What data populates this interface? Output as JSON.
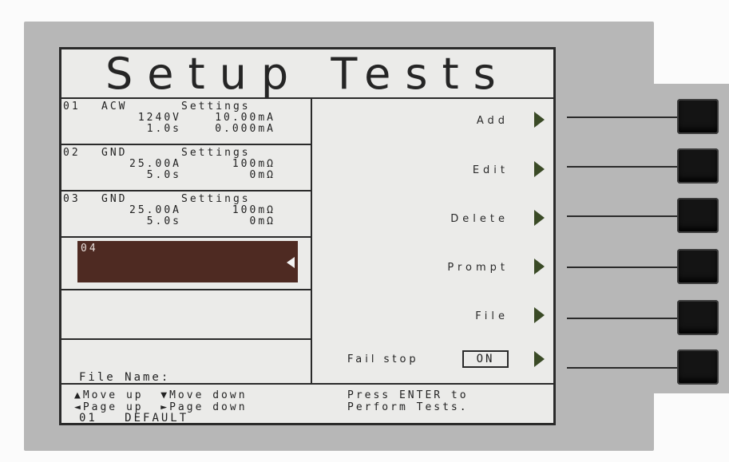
{
  "screen": {
    "title": "Setup Tests"
  },
  "tests": [
    {
      "num": "01",
      "line1": [
        "ACW",
        "Settings"
      ],
      "line2": [
        "1240V",
        "10.00mA"
      ],
      "line3": [
        "1.0s",
        "0.000mA"
      ]
    },
    {
      "num": "02",
      "line1": [
        "GND",
        "Settings"
      ],
      "line2": [
        "25.00A",
        "100mΩ"
      ],
      "line3": [
        "5.0s",
        "0mΩ"
      ]
    },
    {
      "num": "03",
      "line1": [
        "GND",
        "Settings"
      ],
      "line2": [
        "25.00A",
        "100mΩ"
      ],
      "line3": [
        "5.0s",
        "0mΩ"
      ]
    }
  ],
  "selected_slot": {
    "num": "04"
  },
  "file": {
    "label": "File Name:",
    "number": "01",
    "name": "DEFAULT"
  },
  "menu": {
    "add": "Add",
    "edit": "Edit",
    "delete": "Delete",
    "prompt": "Prompt",
    "file": "File",
    "fail_stop_label": "Fail stop",
    "fail_stop_value": "ON"
  },
  "footer": {
    "left_line1": "▲Move up  ▼Move down",
    "left_line2": "◄Page up  ►Page down",
    "right_line1": "Press ENTER to",
    "right_line2": "Perform Tests."
  }
}
